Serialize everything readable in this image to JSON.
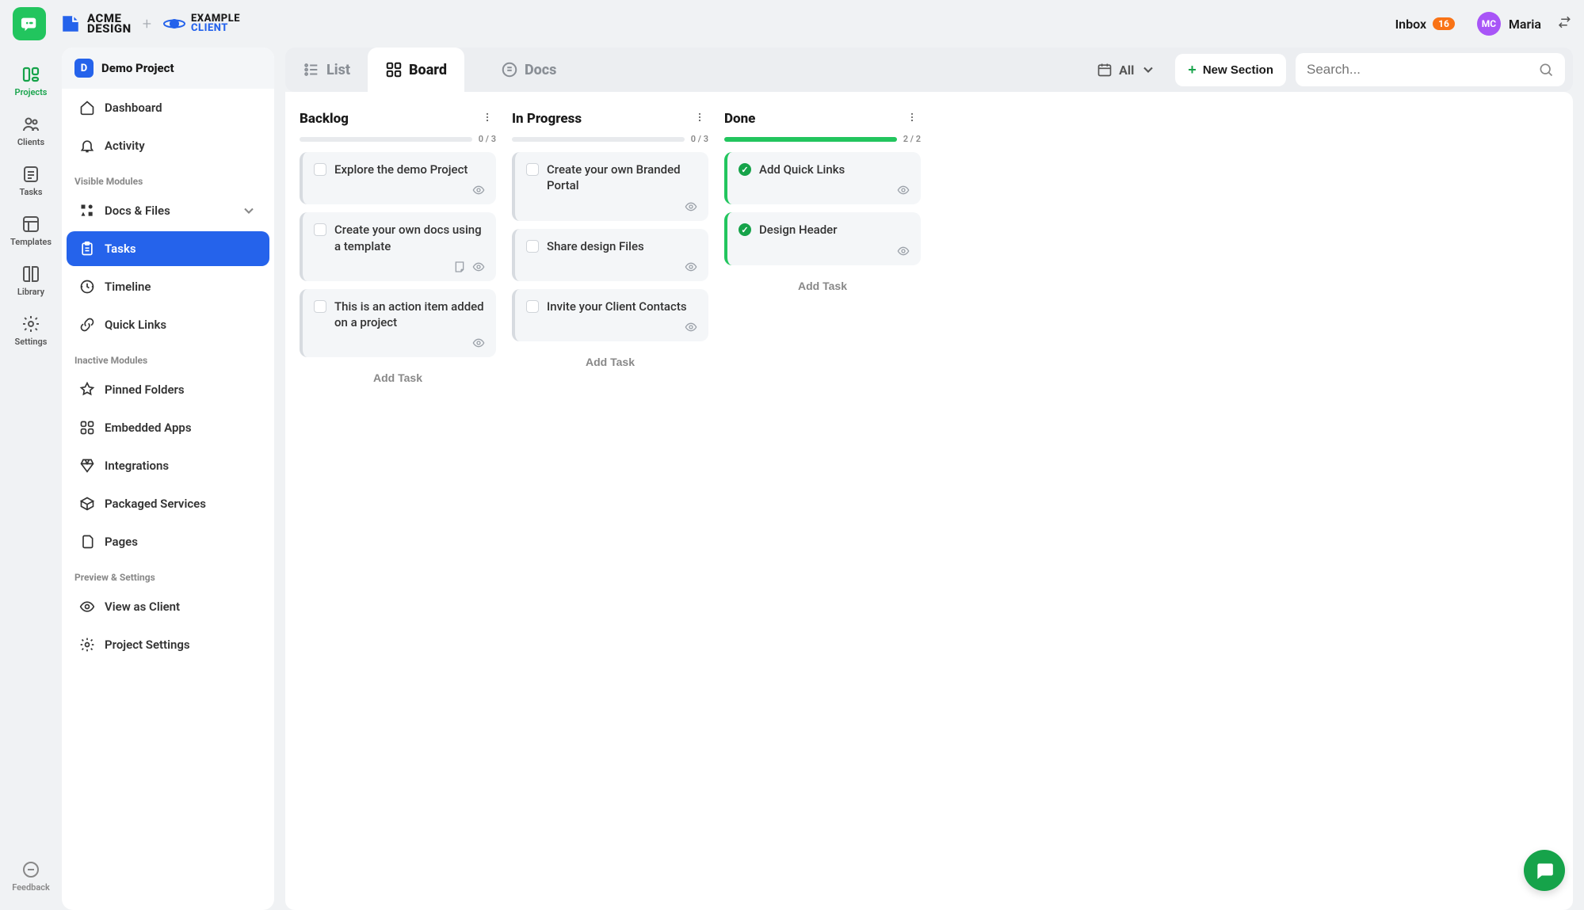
{
  "topbar": {
    "brand_acme_line1": "ACME",
    "brand_acme_line2": "DESIGN",
    "brand_client_line1": "EXAMPLE",
    "brand_client_line2": "CLIENT",
    "inbox_label": "Inbox",
    "inbox_count": "16",
    "user_initials": "MC",
    "user_name": "Maria"
  },
  "rail": {
    "projects": "Projects",
    "clients": "Clients",
    "tasks": "Tasks",
    "templates": "Templates",
    "library": "Library",
    "settings": "Settings",
    "feedback": "Feedback"
  },
  "sidebar": {
    "project_badge": "D",
    "project_name": "Demo Project",
    "dashboard": "Dashboard",
    "activity": "Activity",
    "header_visible": "Visible Modules",
    "docs_files": "Docs & Files",
    "tasks": "Tasks",
    "timeline": "Timeline",
    "quick_links": "Quick Links",
    "header_inactive": "Inactive Modules",
    "pinned_folders": "Pinned Folders",
    "embedded_apps": "Embedded Apps",
    "integrations": "Integrations",
    "packaged_services": "Packaged Services",
    "pages": "Pages",
    "header_preview": "Preview & Settings",
    "view_as_client": "View as Client",
    "project_settings": "Project Settings"
  },
  "toolbar": {
    "tab_list": "List",
    "tab_board": "Board",
    "tab_docs": "Docs",
    "filter_label": "All",
    "new_section": "New Section",
    "search_placeholder": "Search..."
  },
  "board": {
    "add_task": "Add Task",
    "columns": [
      {
        "title": "Backlog",
        "progress": "0 / 3",
        "progress_pct": 0,
        "cards": [
          {
            "title": "Explore the demo Project",
            "done": false,
            "has_note": false
          },
          {
            "title": "Create your own docs using a template",
            "done": false,
            "has_note": true
          },
          {
            "title": "This is an action item added on a project",
            "done": false,
            "has_note": false
          }
        ]
      },
      {
        "title": "In Progress",
        "progress": "0 / 3",
        "progress_pct": 0,
        "cards": [
          {
            "title": "Create your own Branded Portal",
            "done": false,
            "has_note": false
          },
          {
            "title": "Share design Files",
            "done": false,
            "has_note": false
          },
          {
            "title": "Invite your Client Contacts",
            "done": false,
            "has_note": false
          }
        ]
      },
      {
        "title": "Done",
        "progress": "2 / 2",
        "progress_pct": 100,
        "cards": [
          {
            "title": "Add Quick Links",
            "done": true,
            "has_note": false
          },
          {
            "title": "Design Header",
            "done": true,
            "has_note": false
          }
        ]
      }
    ]
  }
}
